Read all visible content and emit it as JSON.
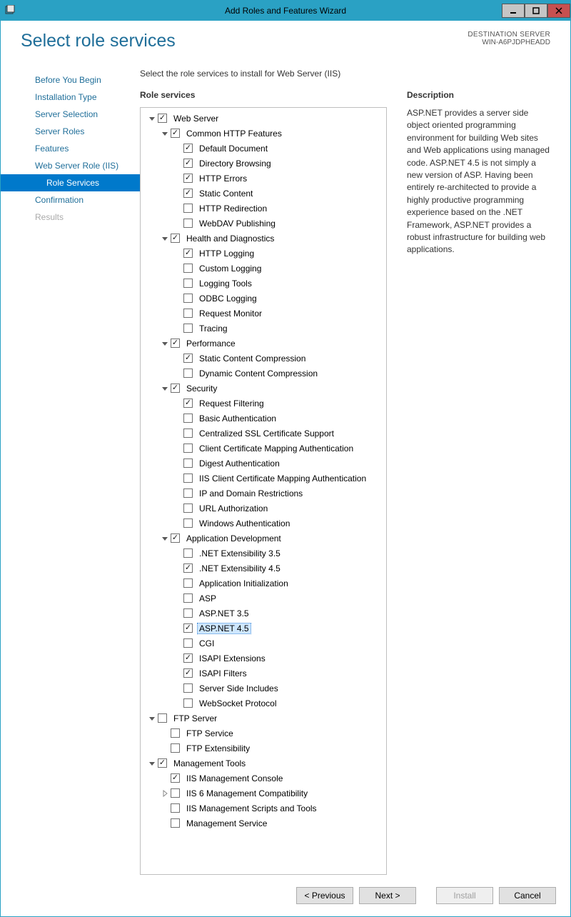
{
  "window": {
    "title": "Add Roles and Features Wizard"
  },
  "header": {
    "title": "Select role services",
    "dest_label": "DESTINATION SERVER",
    "dest_value": "WIN-A6PJDPHEADD"
  },
  "sidebar": {
    "steps": [
      {
        "label": "Before You Begin",
        "active": false,
        "sub": false,
        "disabled": false
      },
      {
        "label": "Installation Type",
        "active": false,
        "sub": false,
        "disabled": false
      },
      {
        "label": "Server Selection",
        "active": false,
        "sub": false,
        "disabled": false
      },
      {
        "label": "Server Roles",
        "active": false,
        "sub": false,
        "disabled": false
      },
      {
        "label": "Features",
        "active": false,
        "sub": false,
        "disabled": false
      },
      {
        "label": "Web Server Role (IIS)",
        "active": false,
        "sub": false,
        "disabled": false
      },
      {
        "label": "Role Services",
        "active": true,
        "sub": true,
        "disabled": false
      },
      {
        "label": "Confirmation",
        "active": false,
        "sub": false,
        "disabled": false
      },
      {
        "label": "Results",
        "active": false,
        "sub": false,
        "disabled": true
      }
    ]
  },
  "main": {
    "instruct": "Select the role services to install for Web Server (IIS)",
    "role_services_label": "Role services",
    "description_label": "Description",
    "description_text": "ASP.NET provides a server side object oriented programming environment for building Web sites and Web applications using managed code. ASP.NET 4.5 is not simply a new version of ASP. Having been entirely re-architected to provide a highly productive programming experience based on the .NET Framework, ASP.NET provides a robust infrastructure for building web applications."
  },
  "tree": [
    {
      "depth": 0,
      "exp": "open",
      "chk": true,
      "sel": false,
      "label": "Web Server"
    },
    {
      "depth": 1,
      "exp": "open",
      "chk": true,
      "sel": false,
      "label": "Common HTTP Features"
    },
    {
      "depth": 2,
      "exp": "none",
      "chk": true,
      "sel": false,
      "label": "Default Document"
    },
    {
      "depth": 2,
      "exp": "none",
      "chk": true,
      "sel": false,
      "label": "Directory Browsing"
    },
    {
      "depth": 2,
      "exp": "none",
      "chk": true,
      "sel": false,
      "label": "HTTP Errors"
    },
    {
      "depth": 2,
      "exp": "none",
      "chk": true,
      "sel": false,
      "label": "Static Content"
    },
    {
      "depth": 2,
      "exp": "none",
      "chk": false,
      "sel": false,
      "label": "HTTP Redirection"
    },
    {
      "depth": 2,
      "exp": "none",
      "chk": false,
      "sel": false,
      "label": "WebDAV Publishing"
    },
    {
      "depth": 1,
      "exp": "open",
      "chk": true,
      "sel": false,
      "label": "Health and Diagnostics"
    },
    {
      "depth": 2,
      "exp": "none",
      "chk": true,
      "sel": false,
      "label": "HTTP Logging"
    },
    {
      "depth": 2,
      "exp": "none",
      "chk": false,
      "sel": false,
      "label": "Custom Logging"
    },
    {
      "depth": 2,
      "exp": "none",
      "chk": false,
      "sel": false,
      "label": "Logging Tools"
    },
    {
      "depth": 2,
      "exp": "none",
      "chk": false,
      "sel": false,
      "label": "ODBC Logging"
    },
    {
      "depth": 2,
      "exp": "none",
      "chk": false,
      "sel": false,
      "label": "Request Monitor"
    },
    {
      "depth": 2,
      "exp": "none",
      "chk": false,
      "sel": false,
      "label": "Tracing"
    },
    {
      "depth": 1,
      "exp": "open",
      "chk": true,
      "sel": false,
      "label": "Performance"
    },
    {
      "depth": 2,
      "exp": "none",
      "chk": true,
      "sel": false,
      "label": "Static Content Compression"
    },
    {
      "depth": 2,
      "exp": "none",
      "chk": false,
      "sel": false,
      "label": "Dynamic Content Compression"
    },
    {
      "depth": 1,
      "exp": "open",
      "chk": true,
      "sel": false,
      "label": "Security"
    },
    {
      "depth": 2,
      "exp": "none",
      "chk": true,
      "sel": false,
      "label": "Request Filtering"
    },
    {
      "depth": 2,
      "exp": "none",
      "chk": false,
      "sel": false,
      "label": "Basic Authentication"
    },
    {
      "depth": 2,
      "exp": "none",
      "chk": false,
      "sel": false,
      "label": "Centralized SSL Certificate Support"
    },
    {
      "depth": 2,
      "exp": "none",
      "chk": false,
      "sel": false,
      "label": "Client Certificate Mapping Authentication"
    },
    {
      "depth": 2,
      "exp": "none",
      "chk": false,
      "sel": false,
      "label": "Digest Authentication"
    },
    {
      "depth": 2,
      "exp": "none",
      "chk": false,
      "sel": false,
      "label": "IIS Client Certificate Mapping Authentication"
    },
    {
      "depth": 2,
      "exp": "none",
      "chk": false,
      "sel": false,
      "label": "IP and Domain Restrictions"
    },
    {
      "depth": 2,
      "exp": "none",
      "chk": false,
      "sel": false,
      "label": "URL Authorization"
    },
    {
      "depth": 2,
      "exp": "none",
      "chk": false,
      "sel": false,
      "label": "Windows Authentication"
    },
    {
      "depth": 1,
      "exp": "open",
      "chk": true,
      "sel": false,
      "label": "Application Development"
    },
    {
      "depth": 2,
      "exp": "none",
      "chk": false,
      "sel": false,
      "label": ".NET Extensibility 3.5"
    },
    {
      "depth": 2,
      "exp": "none",
      "chk": true,
      "sel": false,
      "label": ".NET Extensibility 4.5"
    },
    {
      "depth": 2,
      "exp": "none",
      "chk": false,
      "sel": false,
      "label": "Application Initialization"
    },
    {
      "depth": 2,
      "exp": "none",
      "chk": false,
      "sel": false,
      "label": "ASP"
    },
    {
      "depth": 2,
      "exp": "none",
      "chk": false,
      "sel": false,
      "label": "ASP.NET 3.5"
    },
    {
      "depth": 2,
      "exp": "none",
      "chk": true,
      "sel": true,
      "label": "ASP.NET 4.5"
    },
    {
      "depth": 2,
      "exp": "none",
      "chk": false,
      "sel": false,
      "label": "CGI"
    },
    {
      "depth": 2,
      "exp": "none",
      "chk": true,
      "sel": false,
      "label": "ISAPI Extensions"
    },
    {
      "depth": 2,
      "exp": "none",
      "chk": true,
      "sel": false,
      "label": "ISAPI Filters"
    },
    {
      "depth": 2,
      "exp": "none",
      "chk": false,
      "sel": false,
      "label": "Server Side Includes"
    },
    {
      "depth": 2,
      "exp": "none",
      "chk": false,
      "sel": false,
      "label": "WebSocket Protocol"
    },
    {
      "depth": 0,
      "exp": "open",
      "chk": false,
      "sel": false,
      "label": "FTP Server"
    },
    {
      "depth": 1,
      "exp": "none",
      "chk": false,
      "sel": false,
      "label": "FTP Service"
    },
    {
      "depth": 1,
      "exp": "none",
      "chk": false,
      "sel": false,
      "label": "FTP Extensibility"
    },
    {
      "depth": 0,
      "exp": "open",
      "chk": true,
      "sel": false,
      "label": "Management Tools"
    },
    {
      "depth": 1,
      "exp": "none",
      "chk": true,
      "sel": false,
      "label": "IIS Management Console"
    },
    {
      "depth": 1,
      "exp": "closed",
      "chk": false,
      "sel": false,
      "label": "IIS 6 Management Compatibility"
    },
    {
      "depth": 1,
      "exp": "none",
      "chk": false,
      "sel": false,
      "label": "IIS Management Scripts and Tools"
    },
    {
      "depth": 1,
      "exp": "none",
      "chk": false,
      "sel": false,
      "label": "Management Service"
    }
  ],
  "footer": {
    "previous": "< Previous",
    "next": "Next >",
    "install": "Install",
    "cancel": "Cancel"
  }
}
